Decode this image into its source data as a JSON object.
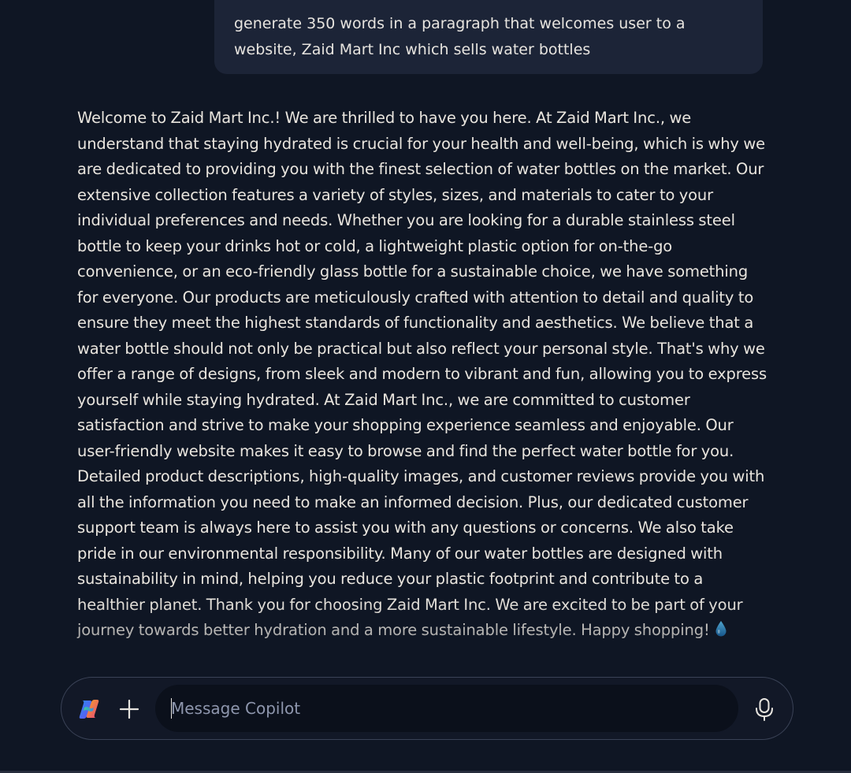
{
  "conversation": {
    "user_message": "generate 350 words in a paragraph that welcomes user to a website, Zaid Mart Inc which sells water bottles",
    "assistant_message": "Welcome to Zaid Mart Inc.! We are thrilled to have you here. At Zaid Mart Inc., we understand that staying hydrated is crucial for your health and well-being, which is why we are dedicated to providing you with the finest selection of water bottles on the market. Our extensive collection features a variety of styles, sizes, and materials to cater to your individual preferences and needs. Whether you are looking for a durable stainless steel bottle to keep your drinks hot or cold, a lightweight plastic option for on-the-go convenience, or an eco-friendly glass bottle for a sustainable choice, we have something for everyone. Our products are meticulously crafted with attention to detail and quality to ensure they meet the highest standards of functionality and aesthetics. We believe that a water bottle should not only be practical but also reflect your personal style. That's why we offer a range of designs, from sleek and modern to vibrant and fun, allowing you to express yourself while staying hydrated. At Zaid Mart Inc., we are committed to customer satisfaction and strive to make your shopping experience seamless and enjoyable. Our user-friendly website makes it easy to browse and find the perfect water bottle for you. Detailed product descriptions, high-quality images, and customer reviews provide you with all the information you need to make an informed decision. Plus, our dedicated customer support team is always here to assist you with any questions or concerns. We also take pride in our environmental responsibility. Many of our water bottles are designed with sustainability in mind, helping you reduce your plastic footprint and contribute to a healthier planet. Thank you for choosing Zaid Mart Inc. We are excited to be part of your journey towards better hydration and a more sustainable lifestyle. Happy shopping!",
    "assistant_emoji_icon": "water-droplet-icon"
  },
  "composer": {
    "placeholder": "Message Copilot",
    "value": "",
    "logo_icon": "copilot-logo-icon",
    "add_icon": "plus-icon",
    "mic_icon": "microphone-icon"
  },
  "colors": {
    "background": "#0f1624",
    "user_bubble": "#1c2437",
    "text": "#e9e5de",
    "placeholder": "#8e96ad",
    "composer_border": "#3a4256"
  }
}
